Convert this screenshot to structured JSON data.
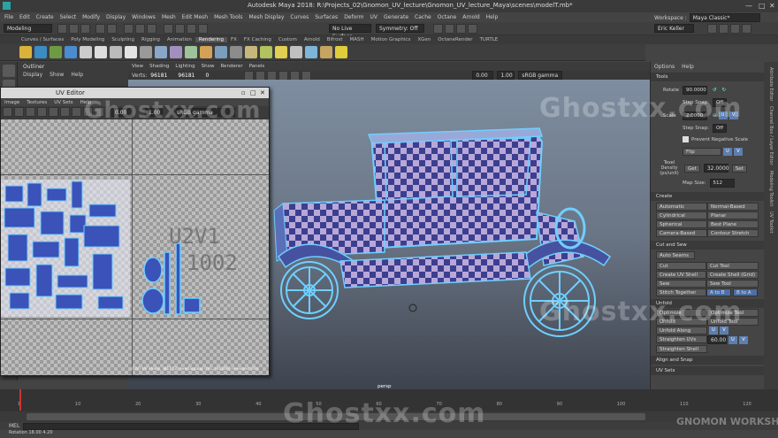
{
  "window": {
    "title": "Autodesk Maya 2018: R:\\Projects_02\\Gnomon_UV_lecture\\Gnomon_UV_lecture_Maya\\scenes\\modelT.mb*"
  },
  "menubar": [
    "File",
    "Edit",
    "Create",
    "Select",
    "Modify",
    "Display",
    "Windows",
    "Mesh",
    "Edit Mesh",
    "Mesh Tools",
    "Mesh Display",
    "Curves",
    "Surfaces",
    "Deform",
    "UV",
    "Generate",
    "Cache",
    "Octane",
    "Arnold",
    "Help"
  ],
  "workspace": {
    "label": "Workspace :",
    "value": "Maya Classic*"
  },
  "statusline": {
    "mode": "Modeling",
    "live": "No Live Surface",
    "symmetry": "Symmetry: Off",
    "user": "Eric Keller"
  },
  "shelf_tabs": [
    "Curves / Surfaces",
    "Poly Modeling",
    "Sculpting",
    "Rigging",
    "Animation",
    "Rendering",
    "FX",
    "FX Caching",
    "Custom",
    "Arnold",
    "Bifrost",
    "MASH",
    "Motion Graphics",
    "XGen",
    "OctaneRender",
    "TURTLE"
  ],
  "shelf_active": "Rendering",
  "outliner": {
    "title": "Outliner",
    "menu": [
      "Display",
      "Show",
      "Help"
    ]
  },
  "viewport": {
    "menu": [
      "View",
      "Shading",
      "Lighting",
      "Show",
      "Renderer",
      "Panels"
    ],
    "verts_label": "Verts:",
    "verts_values": [
      "96181",
      "96181",
      "0"
    ],
    "exposure": "0.00",
    "gamma": "1.00",
    "colorspace": "sRGB gamma",
    "camera": "persp"
  },
  "uv_editor": {
    "title": "UV Editor",
    "menu": [
      "Image",
      "Textures",
      "UV Sets",
      "Help"
    ],
    "exposure": "0.00",
    "gamma": "1.00",
    "colorspace": "sRGB gamma",
    "tile_label_1": "U2V1",
    "tile_label_2": "1002",
    "status": "(UV) UV shells, (81173) overlapping UVs, (91266) reversed UVs"
  },
  "toolkit": {
    "menu": [
      "Options",
      "Help"
    ],
    "tools_header": "Tools",
    "rotate_label": "Rotate",
    "rotate_value": "90.0000",
    "step_snap_label": "Step Snap:",
    "step_snap_value": "Off",
    "scale_label": "Scale",
    "scale_value": "2.0000",
    "u_label": "U",
    "v_label": "V",
    "prevent_negative": "Prevent Negative Scale",
    "flip_label": "Flip",
    "texel_label": "Texel Density (px/unit)",
    "get_label": "Get",
    "texel_value": "32.0000",
    "set_label": "Set",
    "map_size_label": "Map Size:",
    "map_size_value": "512",
    "create_header": "Create",
    "create_items": [
      "Automatic",
      "Normal-Based",
      "Cylindrical",
      "Planar",
      "Spherical",
      "Best Plane",
      "Camera-Based",
      "Contour Stretch"
    ],
    "cutsew_header": "Cut and Sew",
    "auto_seams": "Auto Seams",
    "cutsew_items": [
      "Cut",
      "Cut Tool",
      "Create UV Shell",
      "Create Shell (Grid)",
      "Sew",
      "Sew Tool",
      "Stitch Together",
      "A to B",
      "B to A"
    ],
    "unfold_header": "Unfold",
    "unfold_items": [
      "Optimize",
      "Optimize Tool",
      "Unfold",
      "Unfold Tool",
      "Unfold Along"
    ],
    "straighten_uvs": "Straighten UVs",
    "straighten_value": "60.00",
    "straighten_shell": "Straighten Shell",
    "align_header": "Align and Snap",
    "uvsets_header": "UV Sets"
  },
  "side_tabs": [
    "Attribute Editor",
    "Channel Box / Layer Editor",
    "Modeling Toolkit",
    "UV Toolkit"
  ],
  "timeline": {
    "ticks": [
      "1",
      "10",
      "20",
      "30",
      "40",
      "50",
      "60",
      "70",
      "80",
      "90",
      "100",
      "110",
      "120"
    ]
  },
  "cmdline": {
    "label": "MEL"
  },
  "helpline": {
    "text": "Rotation   18.00    4.20"
  },
  "watermark": {
    "text": "Ghostxx.com",
    "logo": "GNOMON WORKSHOP"
  },
  "colors": {
    "accent": "#4d6fa5",
    "uv_wire": "#6fcfff",
    "checker_dark": "#3b3f8f",
    "checker_light": "#b9a7d8"
  }
}
